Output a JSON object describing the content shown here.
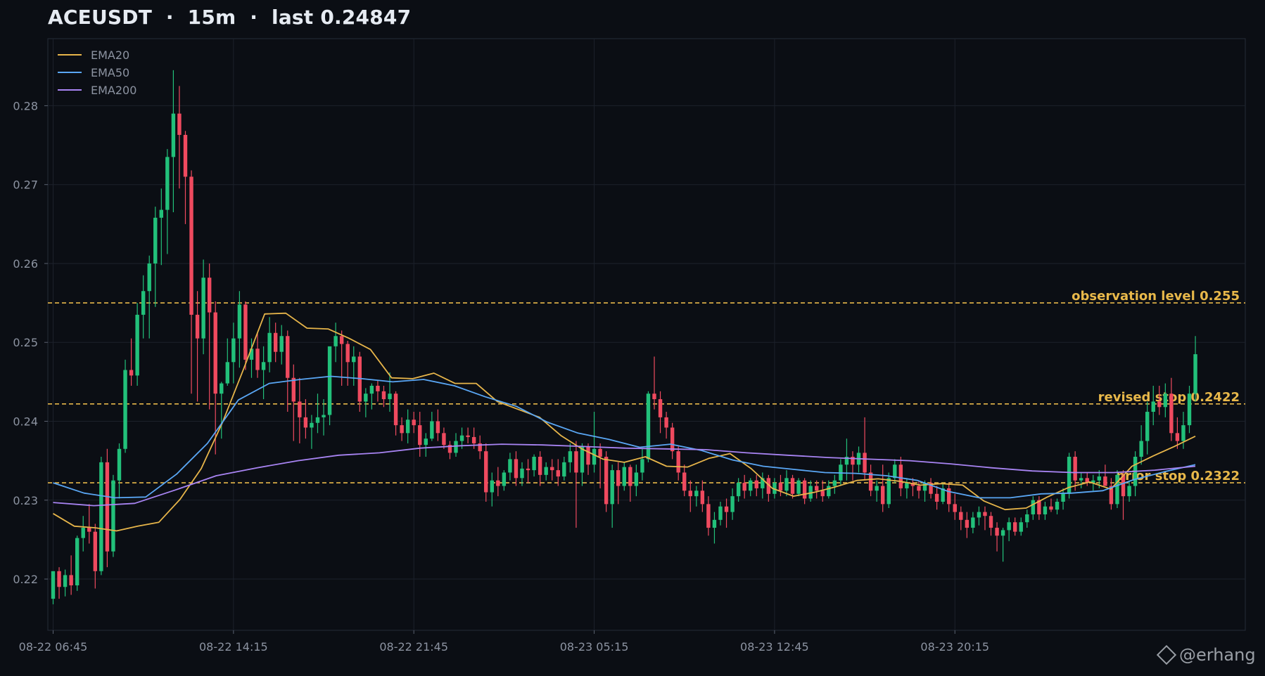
{
  "title": {
    "symbol": "ACEUSDT",
    "interval": "15m",
    "last_label": "last",
    "last_value": "0.24847"
  },
  "colors": {
    "background": "#0b0e14",
    "up": "#22c07a",
    "down": "#ef4a5f",
    "ema20": "#e7b54a",
    "ema50": "#5aa7f5",
    "ema200": "#a884f3",
    "level": "#e8b84a",
    "grid": "#1c212b",
    "axis_text": "#8c93a1"
  },
  "watermark": "@erhang",
  "chart_data": {
    "type": "candlestick",
    "ylim": [
      0.2135,
      0.2885
    ],
    "yticks": [
      0.22,
      0.23,
      0.24,
      0.25,
      0.26,
      0.27,
      0.28
    ],
    "ytick_labels": [
      "0.22",
      "0.23",
      "0.24",
      "0.25",
      "0.26",
      "0.27",
      "0.28"
    ],
    "xticks": [
      {
        "index": 0,
        "label": "08-22 06:45"
      },
      {
        "index": 30,
        "label": "08-22 14:15"
      },
      {
        "index": 60,
        "label": "08-22 21:45"
      },
      {
        "index": 90,
        "label": "08-23 05:15"
      },
      {
        "index": 120,
        "label": "08-23 12:45"
      },
      {
        "index": 150,
        "label": "08-23 20:15"
      }
    ],
    "legend": {
      "placement": "top-left",
      "entries": [
        "EMA20",
        "EMA50",
        "EMA200"
      ]
    },
    "grid": true,
    "levels": [
      {
        "value": 0.255,
        "label": "observation level 0.255"
      },
      {
        "value": 0.2422,
        "label": "revised stop 0.2422"
      },
      {
        "value": 0.2322,
        "label": "prior stop 0.2322"
      }
    ],
    "candles": [
      [
        0.2175,
        0.2208,
        0.2168,
        0.221
      ],
      [
        0.221,
        0.2215,
        0.2175,
        0.219
      ],
      [
        0.219,
        0.2212,
        0.2178,
        0.2205
      ],
      [
        0.2205,
        0.223,
        0.218,
        0.2192
      ],
      [
        0.2192,
        0.2255,
        0.2185,
        0.2252
      ],
      [
        0.2252,
        0.228,
        0.2235,
        0.2265
      ],
      [
        0.2265,
        0.2295,
        0.2245,
        0.226
      ],
      [
        0.226,
        0.227,
        0.2188,
        0.221
      ],
      [
        0.221,
        0.2355,
        0.2205,
        0.2348
      ],
      [
        0.2348,
        0.2365,
        0.2215,
        0.2235
      ],
      [
        0.2235,
        0.2332,
        0.2228,
        0.2325
      ],
      [
        0.2325,
        0.2372,
        0.2302,
        0.2365
      ],
      [
        0.2365,
        0.2478,
        0.236,
        0.2465
      ],
      [
        0.2465,
        0.2505,
        0.2445,
        0.2458
      ],
      [
        0.2458,
        0.255,
        0.2445,
        0.2535
      ],
      [
        0.2535,
        0.2585,
        0.2505,
        0.2565
      ],
      [
        0.2565,
        0.261,
        0.2505,
        0.26
      ],
      [
        0.26,
        0.2672,
        0.2545,
        0.2658
      ],
      [
        0.2658,
        0.2695,
        0.2598,
        0.2668
      ],
      [
        0.2668,
        0.2745,
        0.2612,
        0.2735
      ],
      [
        0.2735,
        0.2845,
        0.2665,
        0.279
      ],
      [
        0.279,
        0.2825,
        0.2695,
        0.2763
      ],
      [
        0.2763,
        0.2768,
        0.265,
        0.271
      ],
      [
        0.271,
        0.2718,
        0.2435,
        0.2535
      ],
      [
        0.2535,
        0.2565,
        0.2425,
        0.2505
      ],
      [
        0.2505,
        0.2605,
        0.2485,
        0.2582
      ],
      [
        0.2582,
        0.26,
        0.2415,
        0.2538
      ],
      [
        0.2538,
        0.2552,
        0.2358,
        0.2435
      ],
      [
        0.2435,
        0.245,
        0.2378,
        0.2448
      ],
      [
        0.2448,
        0.2505,
        0.2445,
        0.2475
      ],
      [
        0.2475,
        0.2525,
        0.2448,
        0.2505
      ],
      [
        0.2505,
        0.2565,
        0.2468,
        0.2548
      ],
      [
        0.2548,
        0.2552,
        0.2465,
        0.2478
      ],
      [
        0.2478,
        0.2505,
        0.2455,
        0.2492
      ],
      [
        0.2492,
        0.2512,
        0.2455,
        0.2465
      ],
      [
        0.2465,
        0.2495,
        0.2428,
        0.2475
      ],
      [
        0.2475,
        0.2532,
        0.2462,
        0.2512
      ],
      [
        0.2512,
        0.2525,
        0.2475,
        0.2488
      ],
      [
        0.2488,
        0.2522,
        0.2472,
        0.2508
      ],
      [
        0.2508,
        0.2515,
        0.2412,
        0.2455
      ],
      [
        0.2455,
        0.2472,
        0.2375,
        0.2425
      ],
      [
        0.2425,
        0.2455,
        0.2372,
        0.2405
      ],
      [
        0.2405,
        0.2428,
        0.2378,
        0.2392
      ],
      [
        0.2392,
        0.2408,
        0.2365,
        0.2398
      ],
      [
        0.2398,
        0.2435,
        0.2385,
        0.2405
      ],
      [
        0.2405,
        0.2428,
        0.2382,
        0.2408
      ],
      [
        0.2408,
        0.2478,
        0.2395,
        0.2495
      ],
      [
        0.2495,
        0.2525,
        0.2475,
        0.2508
      ],
      [
        0.2508,
        0.2515,
        0.2445,
        0.2498
      ],
      [
        0.2498,
        0.2502,
        0.2445,
        0.2475
      ],
      [
        0.2475,
        0.2495,
        0.2445,
        0.2482
      ],
      [
        0.2482,
        0.2488,
        0.2412,
        0.2425
      ],
      [
        0.2425,
        0.2442,
        0.2405,
        0.2435
      ],
      [
        0.2435,
        0.2448,
        0.2415,
        0.2445
      ],
      [
        0.2445,
        0.2452,
        0.2425,
        0.2438
      ],
      [
        0.2438,
        0.2445,
        0.2418,
        0.2428
      ],
      [
        0.2428,
        0.2462,
        0.2412,
        0.2435
      ],
      [
        0.2435,
        0.2438,
        0.2382,
        0.2395
      ],
      [
        0.2395,
        0.2405,
        0.2375,
        0.2385
      ],
      [
        0.2385,
        0.2415,
        0.2372,
        0.2402
      ],
      [
        0.2402,
        0.2412,
        0.2385,
        0.2395
      ],
      [
        0.2395,
        0.2412,
        0.2355,
        0.237
      ],
      [
        0.237,
        0.2385,
        0.2355,
        0.2378
      ],
      [
        0.2378,
        0.2412,
        0.2375,
        0.24
      ],
      [
        0.24,
        0.2415,
        0.2375,
        0.2385
      ],
      [
        0.2385,
        0.2392,
        0.2365,
        0.237
      ],
      [
        0.237,
        0.2375,
        0.2352,
        0.236
      ],
      [
        0.236,
        0.2385,
        0.2355,
        0.2375
      ],
      [
        0.2375,
        0.2392,
        0.2365,
        0.2382
      ],
      [
        0.2382,
        0.2392,
        0.2372,
        0.238
      ],
      [
        0.238,
        0.2392,
        0.2365,
        0.2372
      ],
      [
        0.2372,
        0.2382,
        0.2352,
        0.2362
      ],
      [
        0.2362,
        0.2372,
        0.2298,
        0.231
      ],
      [
        0.231,
        0.2335,
        0.2292,
        0.2325
      ],
      [
        0.2325,
        0.2342,
        0.2305,
        0.2318
      ],
      [
        0.2318,
        0.2338,
        0.2312,
        0.2335
      ],
      [
        0.2335,
        0.236,
        0.2325,
        0.2352
      ],
      [
        0.2352,
        0.2362,
        0.2318,
        0.2328
      ],
      [
        0.2328,
        0.2348,
        0.2318,
        0.234
      ],
      [
        0.234,
        0.2352,
        0.2322,
        0.2338
      ],
      [
        0.2338,
        0.2358,
        0.233,
        0.2355
      ],
      [
        0.2355,
        0.2362,
        0.2318,
        0.2332
      ],
      [
        0.2332,
        0.2348,
        0.2325,
        0.2342
      ],
      [
        0.2342,
        0.2352,
        0.2325,
        0.2338
      ],
      [
        0.2338,
        0.2352,
        0.2318,
        0.233
      ],
      [
        0.233,
        0.2355,
        0.2325,
        0.2348
      ],
      [
        0.2348,
        0.2372,
        0.2335,
        0.2362
      ],
      [
        0.2362,
        0.2375,
        0.2265,
        0.2335
      ],
      [
        0.2335,
        0.2372,
        0.2318,
        0.2368
      ],
      [
        0.2368,
        0.2372,
        0.2332,
        0.2345
      ],
      [
        0.2345,
        0.2412,
        0.2335,
        0.2365
      ],
      [
        0.2365,
        0.2372,
        0.2315,
        0.2355
      ],
      [
        0.2355,
        0.2362,
        0.2285,
        0.2295
      ],
      [
        0.2295,
        0.2345,
        0.2265,
        0.2338
      ],
      [
        0.2338,
        0.2348,
        0.2295,
        0.2318
      ],
      [
        0.2318,
        0.2348,
        0.2312,
        0.2342
      ],
      [
        0.2342,
        0.2345,
        0.2298,
        0.2318
      ],
      [
        0.2318,
        0.2345,
        0.2305,
        0.2335
      ],
      [
        0.2335,
        0.2365,
        0.2325,
        0.2352
      ],
      [
        0.2352,
        0.2438,
        0.2348,
        0.2435
      ],
      [
        0.2435,
        0.2482,
        0.2415,
        0.2428
      ],
      [
        0.2428,
        0.2438,
        0.2385,
        0.2405
      ],
      [
        0.2405,
        0.2412,
        0.2378,
        0.2392
      ],
      [
        0.2392,
        0.2398,
        0.2352,
        0.2362
      ],
      [
        0.2362,
        0.2368,
        0.2325,
        0.2335
      ],
      [
        0.2335,
        0.2345,
        0.2305,
        0.2312
      ],
      [
        0.2312,
        0.2325,
        0.2285,
        0.2305
      ],
      [
        0.2305,
        0.2318,
        0.2292,
        0.2312
      ],
      [
        0.2312,
        0.2325,
        0.2285,
        0.2295
      ],
      [
        0.2295,
        0.2305,
        0.2255,
        0.2265
      ],
      [
        0.2265,
        0.2285,
        0.2245,
        0.2275
      ],
      [
        0.2275,
        0.2298,
        0.2268,
        0.2292
      ],
      [
        0.2292,
        0.2302,
        0.2265,
        0.2285
      ],
      [
        0.2285,
        0.2315,
        0.2275,
        0.2305
      ],
      [
        0.2305,
        0.2328,
        0.2298,
        0.2322
      ],
      [
        0.2322,
        0.2332,
        0.2302,
        0.2312
      ],
      [
        0.2312,
        0.2328,
        0.2305,
        0.2325
      ],
      [
        0.2325,
        0.2332,
        0.2305,
        0.2315
      ],
      [
        0.2315,
        0.2335,
        0.2302,
        0.2328
      ],
      [
        0.2328,
        0.2332,
        0.2298,
        0.2308
      ],
      [
        0.2308,
        0.2328,
        0.2302,
        0.2322
      ],
      [
        0.2322,
        0.2332,
        0.2305,
        0.2312
      ],
      [
        0.2312,
        0.2338,
        0.2305,
        0.2328
      ],
      [
        0.2328,
        0.2332,
        0.2302,
        0.2308
      ],
      [
        0.2308,
        0.2328,
        0.2305,
        0.2325
      ],
      [
        0.2325,
        0.2328,
        0.2295,
        0.2302
      ],
      [
        0.2302,
        0.2325,
        0.2298,
        0.2318
      ],
      [
        0.2318,
        0.2325,
        0.2302,
        0.2312
      ],
      [
        0.2312,
        0.2325,
        0.2298,
        0.2305
      ],
      [
        0.2305,
        0.2325,
        0.2302,
        0.2318
      ],
      [
        0.2318,
        0.2332,
        0.2308,
        0.2325
      ],
      [
        0.2325,
        0.2352,
        0.2318,
        0.2345
      ],
      [
        0.2345,
        0.2378,
        0.2325,
        0.2355
      ],
      [
        0.2355,
        0.2362,
        0.2325,
        0.2345
      ],
      [
        0.2345,
        0.2368,
        0.2335,
        0.236
      ],
      [
        0.236,
        0.2405,
        0.2325,
        0.2335
      ],
      [
        0.2335,
        0.2345,
        0.2305,
        0.2312
      ],
      [
        0.2312,
        0.2325,
        0.2298,
        0.2318
      ],
      [
        0.2318,
        0.2345,
        0.2285,
        0.2295
      ],
      [
        0.2295,
        0.2335,
        0.229,
        0.2328
      ],
      [
        0.2328,
        0.2352,
        0.2322,
        0.2345
      ],
      [
        0.2345,
        0.2355,
        0.2305,
        0.2315
      ],
      [
        0.2315,
        0.2328,
        0.2302,
        0.2322
      ],
      [
        0.2322,
        0.2328,
        0.2305,
        0.2318
      ],
      [
        0.2318,
        0.2325,
        0.2302,
        0.2312
      ],
      [
        0.2312,
        0.2325,
        0.2298,
        0.2322
      ],
      [
        0.2322,
        0.2328,
        0.2302,
        0.2308
      ],
      [
        0.2308,
        0.2318,
        0.2288,
        0.2298
      ],
      [
        0.2298,
        0.2322,
        0.2295,
        0.2315
      ],
      [
        0.2315,
        0.2322,
        0.2285,
        0.2295
      ],
      [
        0.2295,
        0.2308,
        0.2275,
        0.2285
      ],
      [
        0.2285,
        0.2292,
        0.2262,
        0.2275
      ],
      [
        0.2275,
        0.2285,
        0.2252,
        0.2265
      ],
      [
        0.2265,
        0.2285,
        0.2258,
        0.2278
      ],
      [
        0.2278,
        0.2292,
        0.2268,
        0.2285
      ],
      [
        0.2285,
        0.2292,
        0.2262,
        0.228
      ],
      [
        0.228,
        0.2285,
        0.2255,
        0.2265
      ],
      [
        0.2265,
        0.2272,
        0.2235,
        0.2255
      ],
      [
        0.2255,
        0.2265,
        0.2222,
        0.2262
      ],
      [
        0.2262,
        0.2278,
        0.2248,
        0.2272
      ],
      [
        0.2272,
        0.2278,
        0.2255,
        0.226
      ],
      [
        0.226,
        0.2278,
        0.2255,
        0.2272
      ],
      [
        0.2272,
        0.2288,
        0.2265,
        0.2282
      ],
      [
        0.2282,
        0.2305,
        0.2275,
        0.23
      ],
      [
        0.23,
        0.2305,
        0.2275,
        0.2282
      ],
      [
        0.2282,
        0.2298,
        0.2275,
        0.2292
      ],
      [
        0.2292,
        0.2302,
        0.2285,
        0.2288
      ],
      [
        0.2288,
        0.2302,
        0.2282,
        0.2298
      ],
      [
        0.2298,
        0.2315,
        0.2288,
        0.2308
      ],
      [
        0.2308,
        0.236,
        0.2302,
        0.2355
      ],
      [
        0.2355,
        0.2362,
        0.2312,
        0.2325
      ],
      [
        0.2325,
        0.2335,
        0.2315,
        0.2328
      ],
      [
        0.2328,
        0.2335,
        0.2318,
        0.2322
      ],
      [
        0.2322,
        0.2332,
        0.2312,
        0.2325
      ],
      [
        0.2325,
        0.2338,
        0.2315,
        0.233
      ],
      [
        0.233,
        0.2345,
        0.2322,
        0.2318
      ],
      [
        0.2318,
        0.2328,
        0.2288,
        0.2295
      ],
      [
        0.2295,
        0.2338,
        0.229,
        0.2332
      ],
      [
        0.2332,
        0.2338,
        0.2275,
        0.2305
      ],
      [
        0.2305,
        0.2325,
        0.2298,
        0.2318
      ],
      [
        0.2318,
        0.2362,
        0.2305,
        0.2355
      ],
      [
        0.2355,
        0.2395,
        0.2345,
        0.2375
      ],
      [
        0.2375,
        0.2425,
        0.2358,
        0.2412
      ],
      [
        0.2412,
        0.2445,
        0.2395,
        0.2425
      ],
      [
        0.2425,
        0.2445,
        0.2408,
        0.2418
      ],
      [
        0.2418,
        0.2448,
        0.2405,
        0.2435
      ],
      [
        0.2435,
        0.2455,
        0.2375,
        0.2385
      ],
      [
        0.2385,
        0.2405,
        0.2365,
        0.2375
      ],
      [
        0.2375,
        0.2412,
        0.2365,
        0.2395
      ],
      [
        0.2395,
        0.2445,
        0.2385,
        0.2435
      ],
      [
        0.2435,
        0.2508,
        0.2425,
        0.2485
      ]
    ],
    "series": [
      {
        "name": "EMA20",
        "values": [
          0.2283,
          0.2267,
          0.2265,
          0.2261,
          0.2267,
          0.2272,
          0.2301,
          0.234,
          0.2398,
          0.2466,
          0.2536,
          0.2537,
          0.2518,
          0.2517,
          0.2505,
          0.2491,
          0.2455,
          0.2454,
          0.2461,
          0.2448,
          0.2448,
          0.2425,
          0.2415,
          0.2405,
          0.2382,
          0.2365,
          0.2352,
          0.2348,
          0.2355,
          0.2343,
          0.2342,
          0.2353,
          0.2359,
          0.234,
          0.2315,
          0.2305,
          0.231,
          0.2317,
          0.2325,
          0.2327,
          0.2324,
          0.2319,
          0.2321,
          0.2319,
          0.2299,
          0.2288,
          0.229,
          0.2304,
          0.2316,
          0.2323,
          0.2314,
          0.2343,
          0.2356,
          0.2368,
          0.2381
        ]
      },
      {
        "name": "EMA50",
        "values": [
          0.2322,
          0.2309,
          0.2303,
          0.2304,
          0.2333,
          0.2372,
          0.2427,
          0.2448,
          0.2453,
          0.2457,
          0.2454,
          0.245,
          0.2453,
          0.2445,
          0.2431,
          0.2419,
          0.2399,
          0.2385,
          0.2377,
          0.2367,
          0.2371,
          0.2363,
          0.2351,
          0.2343,
          0.2339,
          0.2335,
          0.2334,
          0.2331,
          0.2325,
          0.2311,
          0.2303,
          0.2303,
          0.2308,
          0.2309,
          0.2312,
          0.2326,
          0.2336,
          0.2345
        ]
      },
      {
        "name": "EMA200",
        "values": [
          0.2297,
          0.2293,
          0.2296,
          0.2313,
          0.2331,
          0.2341,
          0.235,
          0.2357,
          0.236,
          0.2366,
          0.2369,
          0.2371,
          0.237,
          0.2368,
          0.2366,
          0.2365,
          0.2364,
          0.236,
          0.2357,
          0.2354,
          0.2352,
          0.235,
          0.2346,
          0.2341,
          0.2337,
          0.2335,
          0.2335,
          0.2338,
          0.2343
        ]
      }
    ]
  }
}
